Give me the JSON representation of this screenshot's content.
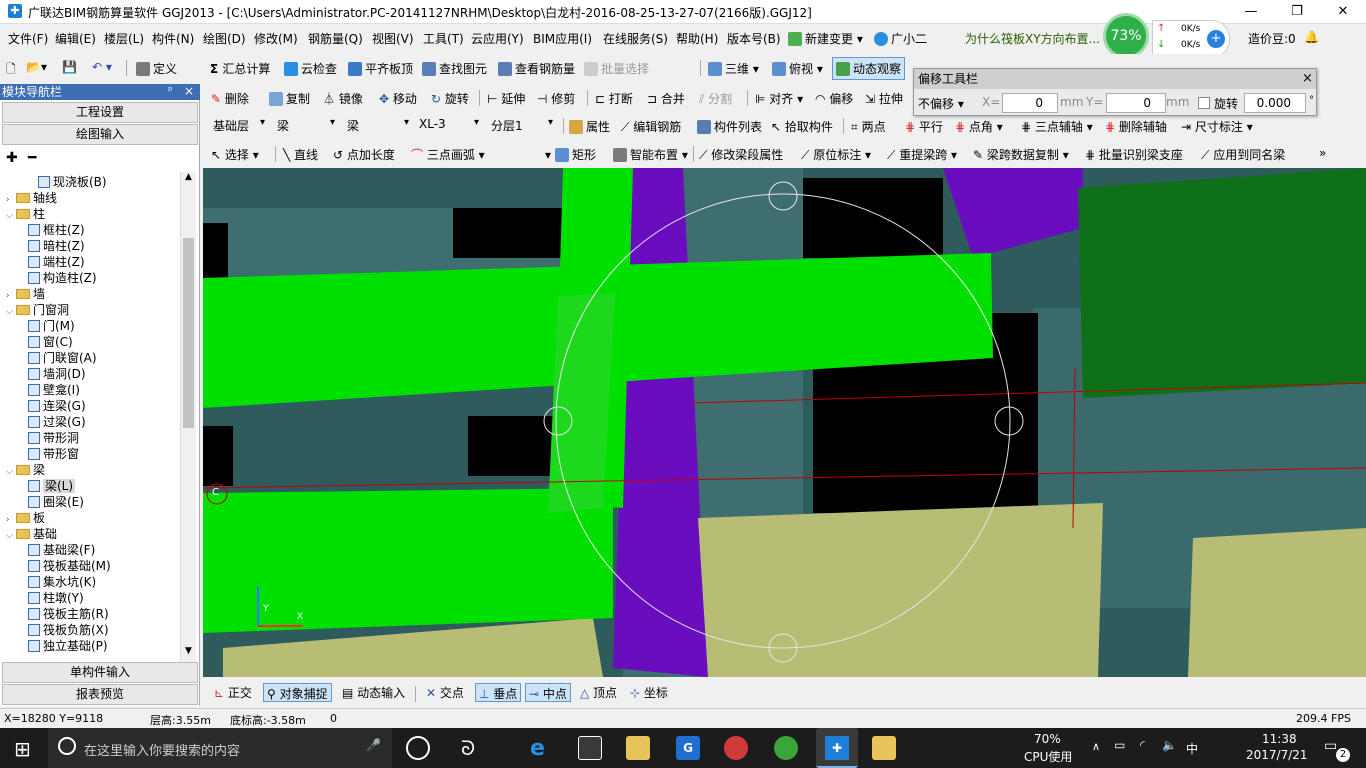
{
  "window": {
    "title": "广联达BIM钢筋算量软件 GGJ2013 - [C:\\Users\\Administrator.PC-20141127NRHM\\Desktop\\白龙村-2016-08-25-13-27-07(2166版).GGJ12]",
    "min_icon": "minimize-icon",
    "max_icon": "restore-icon",
    "close_icon": "close-icon"
  },
  "menu": {
    "items": [
      "文件(F)",
      "编辑(E)",
      "楼层(L)",
      "构件(N)",
      "绘图(D)",
      "修改(M)",
      "钢筋量(Q)",
      "视图(V)",
      "工具(T)",
      "云应用(Y)",
      "BIM应用(I)",
      "在线服务(S)",
      "帮助(H)",
      "版本号(B)"
    ],
    "new_change": "新建变更",
    "guangxiaoer": "广小二",
    "tip": "为什么筏板XY方向布置...",
    "net_percent": "73%",
    "net_up": "0K/s",
    "net_down": "0K/s",
    "zaojiadou": "造价豆:0"
  },
  "toolbar1": {
    "items": [
      "定义",
      "汇总计算",
      "云检查",
      "平齐板顶",
      "查找图元",
      "查看钢筋量",
      "批量选择",
      "三维",
      "俯视",
      "动态观察"
    ]
  },
  "toolbar2": {
    "items": [
      "删除",
      "复制",
      "镜像",
      "移动",
      "旋转",
      "延伸",
      "修剪",
      "打断",
      "合并",
      "分割",
      "对齐",
      "偏移",
      "拉伸"
    ]
  },
  "toolbar3": {
    "floor": "基础层",
    "type": "梁",
    "subtype": "梁",
    "component": "XL-3",
    "layer": "分层1",
    "items": [
      "属性",
      "编辑钢筋",
      "构件列表",
      "拾取构件",
      "两点",
      "平行",
      "点角",
      "三点辅轴",
      "删除辅轴",
      "尺寸标注"
    ]
  },
  "toolbar4": {
    "items": [
      "选择",
      "直线",
      "点加长度",
      "三点画弧",
      "矩形",
      "智能布置",
      "修改梁段属性",
      "原位标注",
      "重提梁跨",
      "梁跨数据复制",
      "批量识别梁支座",
      "应用到同名梁"
    ]
  },
  "offset_tool": {
    "title": "偏移工具栏",
    "mode": "不偏移",
    "x_label": "X=",
    "x_value": "0",
    "y_label": "Y=",
    "y_value": "0",
    "unit": "mm",
    "rotate_label": "旋转",
    "rotate_value": "0.000",
    "degree": "°"
  },
  "left_panel": {
    "title": "模块导航栏",
    "pin": "ᵖ",
    "close": "×",
    "project_settings": "工程设置",
    "drawing_input": "绘图输入",
    "single_input": "单构件输入",
    "report_preview": "报表预览",
    "tree": [
      {
        "label": "现浇板(B)",
        "level": 2,
        "kind": "comp"
      },
      {
        "label": "轴线",
        "level": 0,
        "kind": "folder",
        "tog": "+"
      },
      {
        "label": "柱",
        "level": 0,
        "kind": "folder",
        "tog": "-"
      },
      {
        "label": "框柱(Z)",
        "level": 1,
        "kind": "comp"
      },
      {
        "label": "暗柱(Z)",
        "level": 1,
        "kind": "comp"
      },
      {
        "label": "端柱(Z)",
        "level": 1,
        "kind": "comp"
      },
      {
        "label": "构造柱(Z)",
        "level": 1,
        "kind": "comp"
      },
      {
        "label": "墙",
        "level": 0,
        "kind": "folder",
        "tog": "+"
      },
      {
        "label": "门窗洞",
        "level": 0,
        "kind": "folder",
        "tog": "-"
      },
      {
        "label": "门(M)",
        "level": 1,
        "kind": "comp"
      },
      {
        "label": "窗(C)",
        "level": 1,
        "kind": "comp"
      },
      {
        "label": "门联窗(A)",
        "level": 1,
        "kind": "comp"
      },
      {
        "label": "墙洞(D)",
        "level": 1,
        "kind": "comp"
      },
      {
        "label": "壁龛(I)",
        "level": 1,
        "kind": "comp"
      },
      {
        "label": "连梁(G)",
        "level": 1,
        "kind": "comp"
      },
      {
        "label": "过梁(G)",
        "level": 1,
        "kind": "comp"
      },
      {
        "label": "带形洞",
        "level": 1,
        "kind": "comp"
      },
      {
        "label": "带形窗",
        "level": 1,
        "kind": "comp"
      },
      {
        "label": "梁",
        "level": 0,
        "kind": "folder",
        "tog": "-"
      },
      {
        "label": "梁(L)",
        "level": 1,
        "kind": "comp",
        "selected": true
      },
      {
        "label": "圈梁(E)",
        "level": 1,
        "kind": "comp"
      },
      {
        "label": "板",
        "level": 0,
        "kind": "folder",
        "tog": "+"
      },
      {
        "label": "基础",
        "level": 0,
        "kind": "folder",
        "tog": "-"
      },
      {
        "label": "基础梁(F)",
        "level": 1,
        "kind": "comp"
      },
      {
        "label": "筏板基础(M)",
        "level": 1,
        "kind": "comp"
      },
      {
        "label": "集水坑(K)",
        "level": 1,
        "kind": "comp"
      },
      {
        "label": "柱墩(Y)",
        "level": 1,
        "kind": "comp"
      },
      {
        "label": "筏板主筋(R)",
        "level": 1,
        "kind": "comp"
      },
      {
        "label": "筏板负筋(X)",
        "level": 1,
        "kind": "comp"
      },
      {
        "label": "独立基础(P)",
        "level": 1,
        "kind": "comp"
      }
    ]
  },
  "viewport": {
    "axis_label": "C",
    "axis_x": "X",
    "axis_y": "Y"
  },
  "bottom_toolbar": {
    "items": [
      {
        "label": "正交",
        "on": false
      },
      {
        "label": "对象捕捉",
        "on": true
      },
      {
        "label": "动态输入",
        "on": false
      },
      {
        "label": "交点",
        "on": false
      },
      {
        "label": "垂点",
        "on": true
      },
      {
        "label": "中点",
        "on": true
      },
      {
        "label": "顶点",
        "on": false
      },
      {
        "label": "坐标",
        "on": false
      }
    ]
  },
  "status": {
    "coords": "X=18280 Y=9118",
    "floor_height": "层高:3.55m",
    "bottom_elev": "底标高:-3.58m",
    "zero": "0",
    "fps": "209.4 FPS"
  },
  "taskbar": {
    "search_placeholder": "在这里输入你要搜索的内容",
    "cpu_percent": "70%",
    "cpu_label": "CPU使用",
    "time": "11:38",
    "date": "2017/7/21",
    "notif_count": "2"
  },
  "colors": {
    "beam_green": "#00e000",
    "purple": "#6a0dbf",
    "teal": "#2e5b5b",
    "khaki": "#b7bd74",
    "dark_green": "#0d6f18"
  }
}
